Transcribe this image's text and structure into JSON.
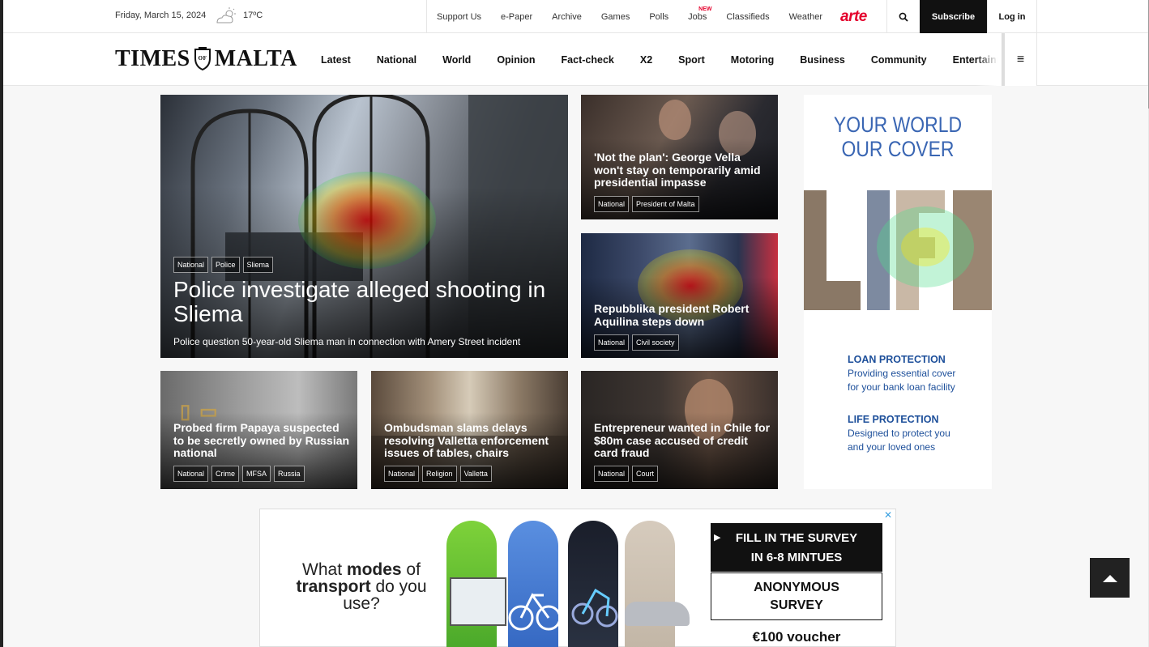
{
  "topbar": {
    "date": "Friday, March 15, 2024",
    "temperature": "17ºC",
    "links": [
      "Support Us",
      "e-Paper",
      "Archive",
      "Games",
      "Polls",
      "Jobs",
      "Classifieds",
      "Weather"
    ],
    "jobs_badge": "NEW",
    "partner_logo": "arte",
    "subscribe": "Subscribe",
    "login": "Log in"
  },
  "nav": {
    "logo_left": "TIMES",
    "logo_crest": "OF",
    "logo_right": "MALTA",
    "items": [
      "Latest",
      "National",
      "World",
      "Opinion",
      "Fact-check",
      "X2",
      "Sport",
      "Motoring",
      "Business",
      "Community",
      "Entertainment"
    ]
  },
  "hero": {
    "tags": [
      "National",
      "Police",
      "Sliema"
    ],
    "headline": "Police investigate alleged shooting in Sliema",
    "sub": "Police question 50-year-old Sliema man in connection with Amery Street incident"
  },
  "cards": [
    {
      "headline": "'Not the plan': George Vella won't stay on temporarily amid presidential impasse",
      "tags": [
        "National",
        "President of Malta"
      ]
    },
    {
      "headline": "Repubblika president Robert Aquilina steps down",
      "tags": [
        "National",
        "Civil society"
      ]
    },
    {
      "headline": "Probed firm Papaya suspected to be secretly owned by Russian national",
      "tags": [
        "National",
        "Crime",
        "MFSA",
        "Russia"
      ]
    },
    {
      "headline": "Ombudsman slams delays resolving Valletta enforcement issues of tables, chairs",
      "tags": [
        "National",
        "Religion",
        "Valletta"
      ]
    },
    {
      "headline": "Entrepreneur wanted in Chile for $80m case accused of credit card fraud",
      "tags": [
        "National",
        "Court"
      ]
    }
  ],
  "side_ad": {
    "heading_1": "YOUR WORLD",
    "heading_2": "OUR COVER",
    "block1_title": "LOAN PROTECTION",
    "block1_line1": "Providing essential cover",
    "block1_line2": "for your bank loan facility",
    "block2_title": "LIFE PROTECTION",
    "block2_line1": "Designed to protect you",
    "block2_line2": "and your loved ones"
  },
  "banner": {
    "q1": "What ",
    "q2": "modes",
    "q3": " of",
    "q4": "transport",
    "q5": " do you",
    "q6": "use?",
    "survey_line1": "FILL IN THE SURVEY",
    "survey_line2": "IN 6-8 MINTUES",
    "anon_line1": "ANONYMOUS",
    "anon_line2": "SURVEY",
    "voucher": "€100 voucher"
  }
}
